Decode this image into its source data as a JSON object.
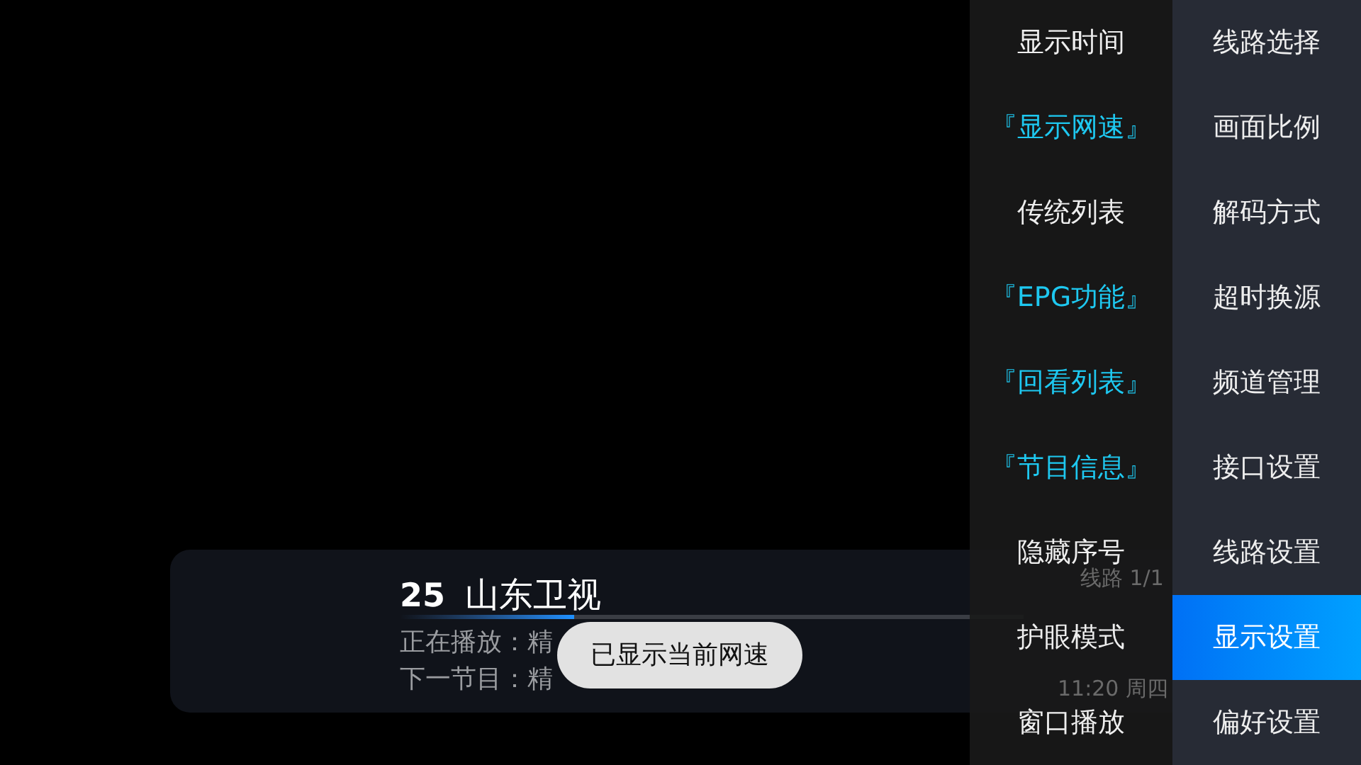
{
  "info_bar": {
    "channel_number": "25",
    "channel_name": "山东卫视",
    "progress": {
      "level": 0.28
    },
    "now_playing": "正在播放：精",
    "next_program": "下一节目：精",
    "line": "线路 1/1",
    "time": "11:20 周四"
  },
  "toast": "已显示当前网速",
  "settings_menu": {
    "options": [
      {
        "label": "显示时间",
        "on": false
      },
      {
        "label": "『显示网速』",
        "on": true
      },
      {
        "label": "传统列表",
        "on": false
      },
      {
        "label": "『EPG功能』",
        "on": true
      },
      {
        "label": "『回看列表』",
        "on": true
      },
      {
        "label": "『节目信息』",
        "on": true
      },
      {
        "label": "隐藏序号",
        "on": false
      },
      {
        "label": "护眼模式",
        "on": false
      },
      {
        "label": "窗口播放",
        "on": false
      }
    ],
    "categories": [
      {
        "label": "线路选择",
        "selected": false
      },
      {
        "label": "画面比例",
        "selected": false
      },
      {
        "label": "解码方式",
        "selected": false
      },
      {
        "label": "超时换源",
        "selected": false
      },
      {
        "label": "频道管理",
        "selected": false
      },
      {
        "label": "接口设置",
        "selected": false
      },
      {
        "label": "线路设置",
        "selected": false
      },
      {
        "label": "显示设置",
        "selected": true
      },
      {
        "label": "偏好设置",
        "selected": false
      }
    ]
  }
}
